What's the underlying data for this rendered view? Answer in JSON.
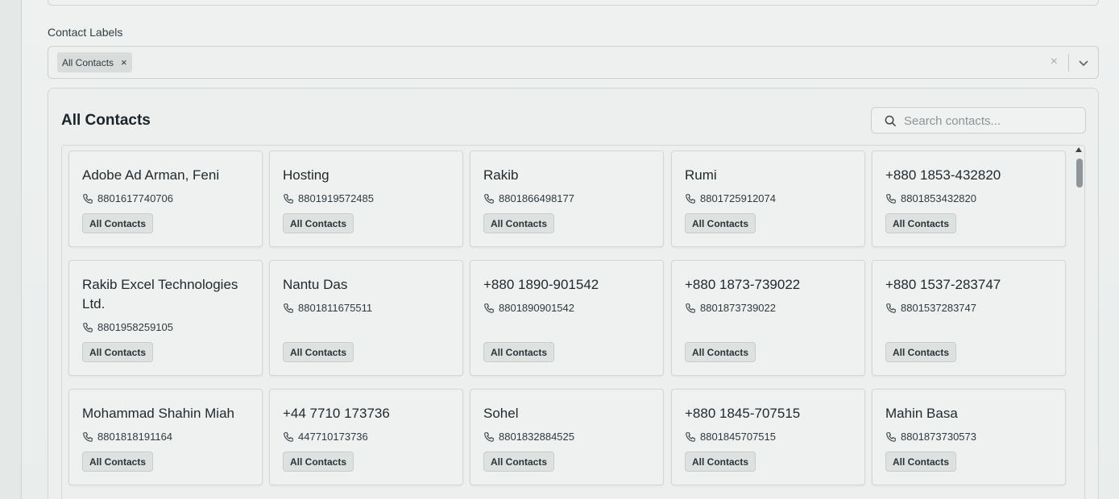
{
  "contact_labels": {
    "label": "Contact Labels",
    "selected_chip": "All Contacts",
    "chip_remove": "×",
    "clear": "×"
  },
  "panel": {
    "title": "All Contacts",
    "search_placeholder": "Search contacts..."
  },
  "contacts": [
    {
      "name": "Adobe Ad Arman, Feni",
      "phone": "8801617740706",
      "label": "All Contacts"
    },
    {
      "name": "Hosting",
      "phone": "8801919572485",
      "label": "All Contacts"
    },
    {
      "name": "Rakib",
      "phone": "8801866498177",
      "label": "All Contacts"
    },
    {
      "name": "Rumi",
      "phone": "8801725912074",
      "label": "All Contacts"
    },
    {
      "name": "+880 1853-432820",
      "phone": "8801853432820",
      "label": "All Contacts"
    },
    {
      "name": "Rakib Excel Technologies Ltd.",
      "phone": "8801958259105",
      "label": "All Contacts"
    },
    {
      "name": "Nantu Das",
      "phone": "8801811675511",
      "label": "All Contacts"
    },
    {
      "name": "+880 1890-901542",
      "phone": "8801890901542",
      "label": "All Contacts"
    },
    {
      "name": "+880 1873-739022",
      "phone": "8801873739022",
      "label": "All Contacts"
    },
    {
      "name": "+880 1537-283747",
      "phone": "8801537283747",
      "label": "All Contacts"
    },
    {
      "name": "Mohammad Shahin Miah",
      "phone": "8801818191164",
      "label": "All Contacts"
    },
    {
      "name": "+44 7710 173736",
      "phone": "447710173736",
      "label": "All Contacts"
    },
    {
      "name": "Sohel",
      "phone": "8801832884525",
      "label": "All Contacts"
    },
    {
      "name": "+880 1845-707515",
      "phone": "8801845707515",
      "label": "All Contacts"
    },
    {
      "name": "Mahin Basa",
      "phone": "8801873730573",
      "label": "All Contacts"
    }
  ]
}
